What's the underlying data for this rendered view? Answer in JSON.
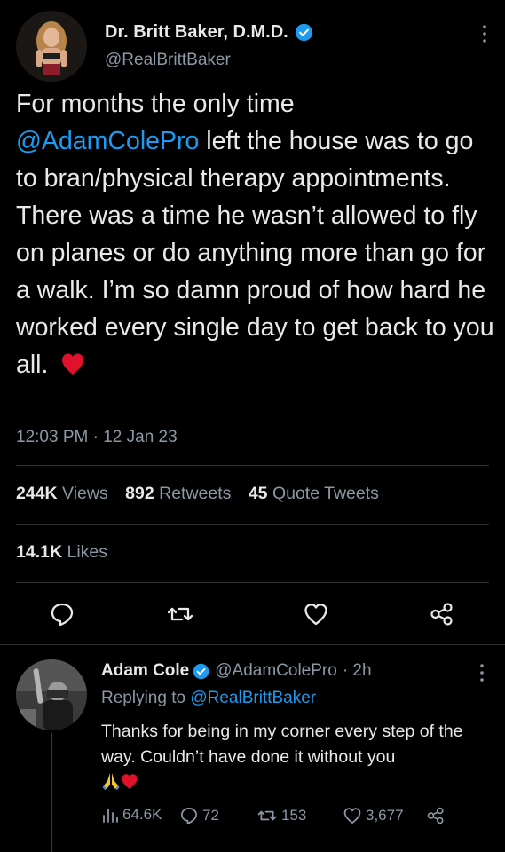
{
  "tweet": {
    "author_name": "Dr. Britt Baker, D.M.D.",
    "author_handle": "@RealBrittBaker",
    "text_line1": "For months the only time",
    "mention": "@AdamColePro",
    "text_after_mention": " left the house was to go to bran/physical therapy appointments. There was a time he wasn’t allowed to fly on planes or do anything more than go for a walk. I’m so damn proud of how hard he worked every single day to get back to you all.",
    "timestamp": "12:03 PM · 12 Jan 23",
    "stats": {
      "views_count": "244K",
      "views_label": "Views",
      "retweets_count": "892",
      "retweets_label": "Retweets",
      "quotes_count": "45",
      "quotes_label": "Quote Tweets",
      "likes_count": "14.1K",
      "likes_label": "Likes"
    },
    "actions": [
      "reply-icon",
      "retweet-icon",
      "like-icon",
      "share-icon"
    ]
  },
  "reply": {
    "author_name": "Adam Cole",
    "author_handle": "@AdamColePro",
    "time": "· 2h",
    "replying_label": "Replying to",
    "replying_to": "@RealBrittBaker",
    "text": "Thanks for being in my corner every step of the way. Couldn’t have done it without you",
    "views": "64.6K",
    "replies": "72",
    "retweets": "153",
    "likes": "3,677"
  },
  "colors": {
    "background": "#000000",
    "text": "#e7e9ea",
    "secondary": "#8b98a5",
    "link": "#1d9bf0",
    "verified": "#1d9bf0",
    "divider": "#2f3336",
    "heart": "#e0112b"
  }
}
